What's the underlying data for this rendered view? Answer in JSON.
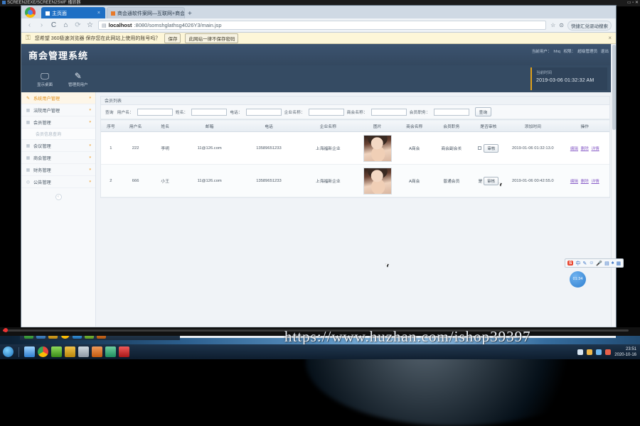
{
  "player": {
    "title": "SCREEN2EXE/SCREEN2SWF 播放器",
    "window_buttons": [
      "—",
      "□",
      "✕"
    ]
  },
  "browser": {
    "tabs": [
      {
        "label": "主页面",
        "active": true,
        "close": "×"
      },
      {
        "label": "商会通软件案网—互联网+商会",
        "active": false,
        "close": "×"
      }
    ],
    "new_tab": "+",
    "nav": {
      "back": "‹",
      "forward": "›",
      "reload": "C",
      "home": "⌂",
      "stop": "⟳",
      "star": "☆"
    },
    "url_prefix": "localhost",
    "url_rest": ":8080/somshglathsg4026Y3/main.jsp",
    "lock_icon": "page-icon",
    "right_buttons": [
      "☆",
      "⊙",
      "⚙"
    ],
    "right_pill": "快捷汇兑驱动搜索",
    "infobar": {
      "key_icon": "key-icon",
      "text": "您希望 360极速浏览器 保存您在此网站上使用的账号吗？",
      "save": "保存",
      "never": "此网站一律不保存密码",
      "close": "×"
    }
  },
  "app": {
    "title": "商会管理系统",
    "user_prefix": "当前用户：",
    "user_name": "hhq",
    "role_prefix": "权限：",
    "role": "超级管理员",
    "logout": "退出",
    "quick_actions": [
      {
        "icon": "monitor-icon",
        "glyph": "🖵",
        "label": "显示桌面"
      },
      {
        "icon": "pen-icon",
        "glyph": "✎",
        "label": "管理员用户"
      }
    ],
    "clock": {
      "label": "当前时间",
      "value": "2019-03-06 01:32:32 AM"
    },
    "sidebar": {
      "items": [
        {
          "label": "系统用户管理",
          "active": true,
          "caret": "▾",
          "icon": "pen-icon"
        },
        {
          "label": "法院用户管理",
          "active": false,
          "caret": "▾",
          "icon": "grid-icon"
        },
        {
          "label": "会员管理",
          "active": false,
          "caret": "▾",
          "icon": "grid-icon"
        },
        {
          "label": "会议管理",
          "active": false,
          "caret": "▾",
          "icon": "grid-icon"
        },
        {
          "label": "商会管理",
          "active": false,
          "caret": "▾",
          "icon": "grid-icon"
        },
        {
          "label": "财务管理",
          "active": false,
          "caret": "▾",
          "icon": "grid-icon"
        },
        {
          "label": "公告管理",
          "active": false,
          "caret": "▾",
          "icon": "circle-icon"
        }
      ],
      "sub_item": "会员信息查询",
      "collapse": "‹"
    },
    "breadcrumb": "会员列表",
    "search": {
      "prefix": "查询",
      "fields": [
        {
          "label": "用户名：",
          "value": "",
          "placeholder": ""
        },
        {
          "label": "姓名：",
          "value": "",
          "placeholder": ""
        },
        {
          "label": "电话：",
          "value": "",
          "placeholder": ""
        },
        {
          "label": "企业名称：",
          "value": "",
          "placeholder": ""
        },
        {
          "label": "商会名称：",
          "value": "",
          "placeholder": ""
        },
        {
          "label": "会员职务：",
          "value": "",
          "placeholder": ""
        }
      ],
      "submit": "查询"
    },
    "table": {
      "columns": [
        "序号",
        "用户名",
        "姓名",
        "邮箱",
        "电话",
        "企业名称",
        "图片",
        "商会名称",
        "会员职务",
        "是否审核",
        "添加时间",
        "操作"
      ],
      "rows": [
        {
          "no": "1",
          "username": "222",
          "name": "李明",
          "email": "11@126.com",
          "phone": "13589651233",
          "company": "上海福新企业",
          "photo": "member-photo",
          "chamber": "A商会",
          "position": "商会副会长",
          "audited_flag": "",
          "audit_button": "审核",
          "created": "2019-01-06 01:32:13.0",
          "actions": [
            "编辑",
            "删除",
            "详情"
          ]
        },
        {
          "no": "2",
          "username": "666",
          "name": "小王",
          "email": "11@126.com",
          "phone": "13589651233",
          "company": "上海福新企业",
          "photo": "member-photo",
          "chamber": "A商会",
          "position": "普通会员",
          "audited_flag": "是",
          "audit_button": "审核",
          "created": "2019-01-06 00:42:55.0",
          "actions": [
            "编辑",
            "删除",
            "详情"
          ]
        }
      ]
    }
  },
  "ime": {
    "brand": "S",
    "mode": "中",
    "icons": [
      "✎",
      "☺",
      "🎤",
      "⌨",
      "▤",
      "♠",
      "▦"
    ]
  },
  "float_clock": "01:34",
  "watermark": "https://www.huzhan.com/ishop39397",
  "taskbar": {
    "clock_time": "23:51",
    "clock_date": "2020-10-16"
  }
}
